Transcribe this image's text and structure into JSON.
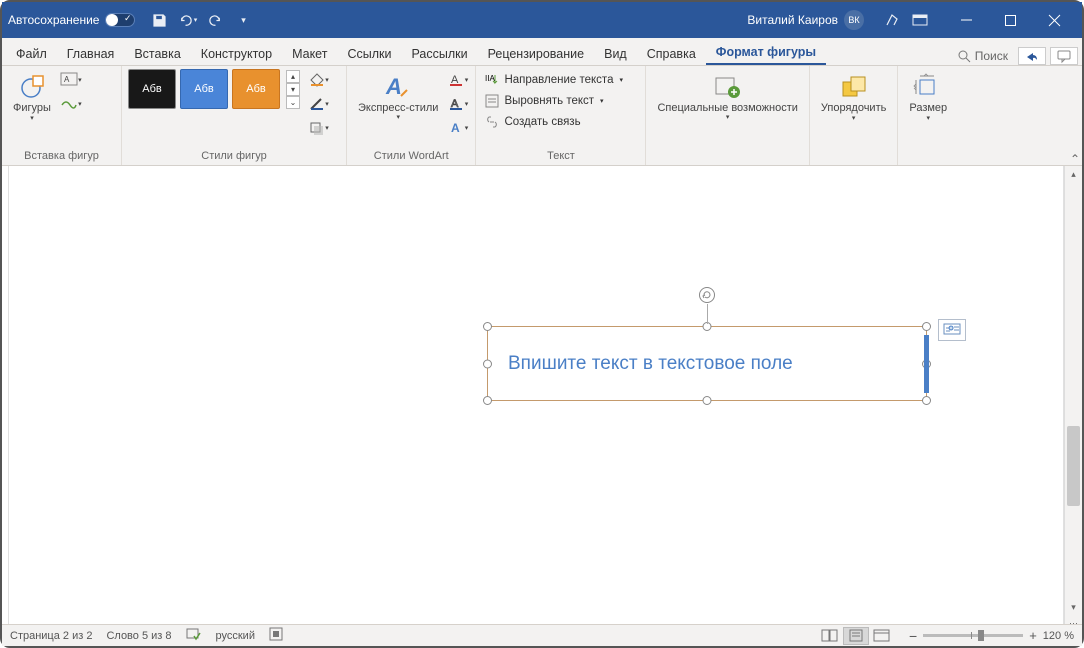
{
  "titlebar": {
    "autosave": "Автосохранение",
    "user": "Виталий Каиров",
    "avatar": "ВК"
  },
  "tabs": {
    "file": "Файл",
    "home": "Главная",
    "insert": "Вставка",
    "design": "Конструктор",
    "layout": "Макет",
    "references": "Ссылки",
    "mailings": "Рассылки",
    "review": "Рецензирование",
    "view": "Вид",
    "help": "Справка",
    "shapeformat": "Формат фигуры",
    "search": "Поиск"
  },
  "ribbon": {
    "shapes": "Фигуры",
    "insert_shapes": "Вставка фигур",
    "shape_styles": "Стили фигур",
    "style_sample": "Абв",
    "wordart_styles": "Стили WordArt",
    "express_styles": "Экспресс-стили",
    "text_group": "Текст",
    "text_direction": "Направление текста",
    "align_text": "Выровнять текст",
    "create_link": "Создать связь",
    "accessibility": "Специальные возможности",
    "arrange": "Упорядочить",
    "size": "Размер"
  },
  "document": {
    "textbox_placeholder": "Впишите текст в текстовое поле"
  },
  "statusbar": {
    "page": "Страница 2 из 2",
    "words": "Слово 5 из 8",
    "language": "русский",
    "zoom": "120 %"
  }
}
